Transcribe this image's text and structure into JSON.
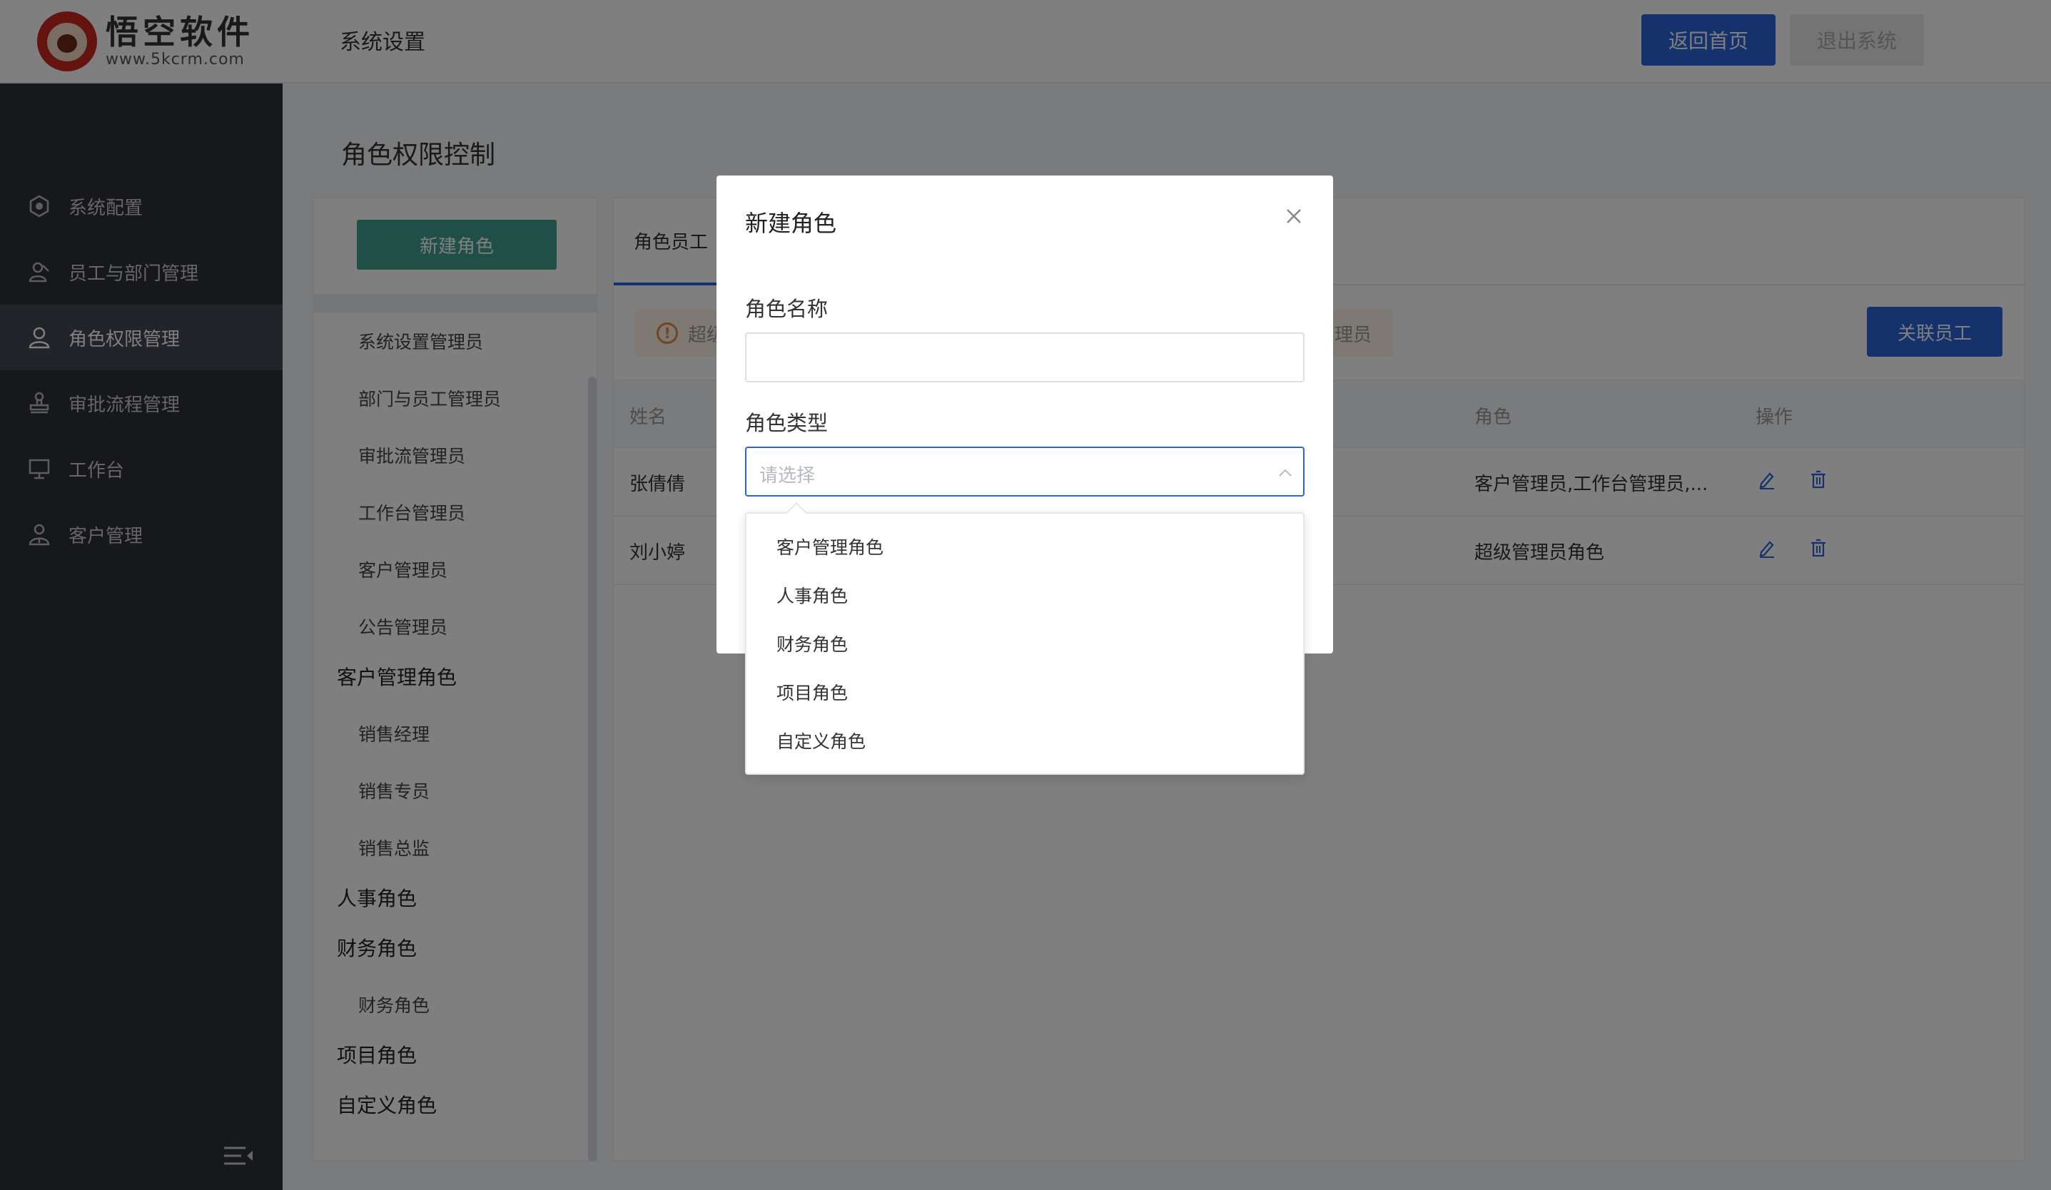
{
  "header": {
    "logo_name": "悟空软件",
    "logo_url": "www.5kcrm.com",
    "title": "系统设置",
    "home_label": "返回首页",
    "logout_label": "退出系统"
  },
  "sidebar": {
    "items": [
      {
        "label": "系统配置",
        "icon": "hexagon-icon"
      },
      {
        "label": "员工与部门管理",
        "icon": "users-icon"
      },
      {
        "label": "角色权限管理",
        "icon": "user-icon",
        "active": true
      },
      {
        "label": "审批流程管理",
        "icon": "stamp-icon"
      },
      {
        "label": "工作台",
        "icon": "monitor-icon"
      },
      {
        "label": "客户管理",
        "icon": "customer-icon"
      }
    ]
  },
  "page": {
    "title": "角色权限控制",
    "new_role_label": "新建角色"
  },
  "role_tree": {
    "leaves_admin": [
      "系统设置管理员",
      "部门与员工管理员",
      "审批流管理员",
      "工作台管理员",
      "客户管理员",
      "公告管理员"
    ],
    "group_customer": "客户管理角色",
    "leaves_customer": [
      "销售经理",
      "销售专员",
      "销售总监"
    ],
    "group_hr": "人事角色",
    "group_finance": "财务角色",
    "leaves_finance": [
      "财务角色"
    ],
    "group_project": "项目角色",
    "group_custom": "自定义角色"
  },
  "main": {
    "tab_label": "角色员工",
    "alert_prefix": "超级",
    "alert_suffix": "理员",
    "link_button": "关联员工",
    "columns": {
      "name": "姓名",
      "role": "角色",
      "action": "操作"
    },
    "rows": [
      {
        "name": "张倩倩",
        "role": "客户管理员,工作台管理员,..."
      },
      {
        "name": "刘小婷",
        "role": "超级管理员角色"
      }
    ]
  },
  "modal": {
    "title": "新建角色",
    "name_label": "角色名称",
    "name_value": "",
    "type_label": "角色类型",
    "type_placeholder": "请选择",
    "options": [
      "客户管理角色",
      "人事角色",
      "财务角色",
      "项目角色",
      "自定义角色"
    ]
  },
  "colors": {
    "accent": "#2a64d8",
    "teal": "#3f9e8e",
    "sidebar_bg": "#2d3037"
  }
}
